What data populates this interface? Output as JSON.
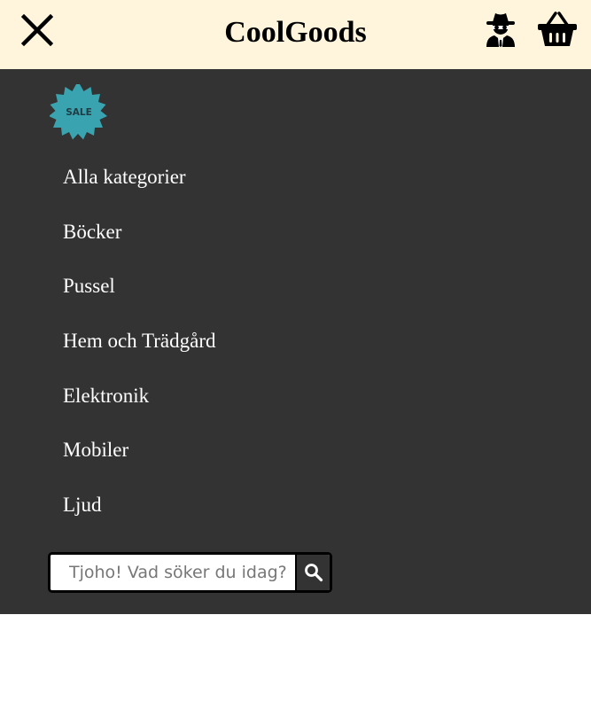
{
  "header": {
    "brand": "CoolGoods",
    "close_icon": "close-icon",
    "account_icon": "user-secret-icon",
    "cart_icon": "shopping-basket-icon",
    "background_color": "#fff5dc"
  },
  "menu": {
    "background_color": "#333333",
    "sale_badge": {
      "text": "SALE",
      "color": "#3aa3b0"
    },
    "items": [
      "Alla kategorier",
      "Böcker",
      "Pussel",
      "Hem och Trädgård",
      "Elektronik",
      "Mobiler",
      "Ljud"
    ]
  },
  "search": {
    "placeholder": "Tjoho! Vad söker du idag?",
    "value": "",
    "button_icon": "search-icon"
  }
}
